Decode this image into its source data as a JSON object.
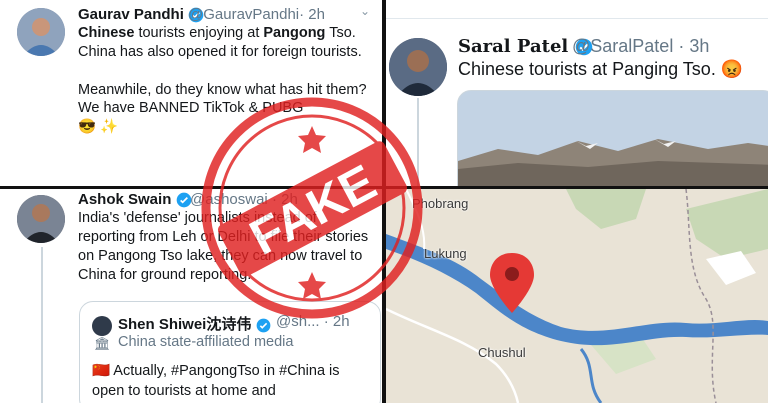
{
  "tweet1": {
    "name": "Gaurav Pandhi",
    "handle": "@GauravPandhi",
    "time": "· 2h",
    "caret": "⌄",
    "line1_bold_a": "Chinese",
    "line1_rest": " tourists enjoying at ",
    "line1_bold_b": "Pangong",
    "line2": "Tso. China has also opened it for foreign tourists.",
    "para2": "Meanwhile, do they know what has hit them? We have BANNED TikTok & PUBG",
    "emoji": "😎 ✨"
  },
  "tweet2": {
    "name": "Saral Patel",
    "handle": "@SaralPatel",
    "time": "· 3h",
    "text": "Chinese tourists at Panging Tso.",
    "emoji": "😡"
  },
  "tweet3": {
    "name": "Ashok Swain",
    "handle": "@ashoswai",
    "time": "· 2h",
    "text": "India's 'defense' journalists instead of reporting from Leh or Delhi to file their stories on Pangong Tso lake, they can now travel to China for ground reporting.",
    "quote": {
      "name": "Shen Shiwei沈诗伟",
      "handle": "@sh...",
      "time": "· 2h",
      "label": "China state-affiliated media",
      "text": "🇨🇳 Actually, #PangongTso in #China is open to tourists at home and"
    }
  },
  "map": {
    "labels": [
      "Phobrang",
      "Lukung",
      "Chushul"
    ]
  },
  "stamp": {
    "text": "FAKE"
  },
  "colors": {
    "verified": "#1da1f2",
    "stamp": "#e02020",
    "water": "#4c86c9",
    "map_land": "#e9e3d6"
  }
}
